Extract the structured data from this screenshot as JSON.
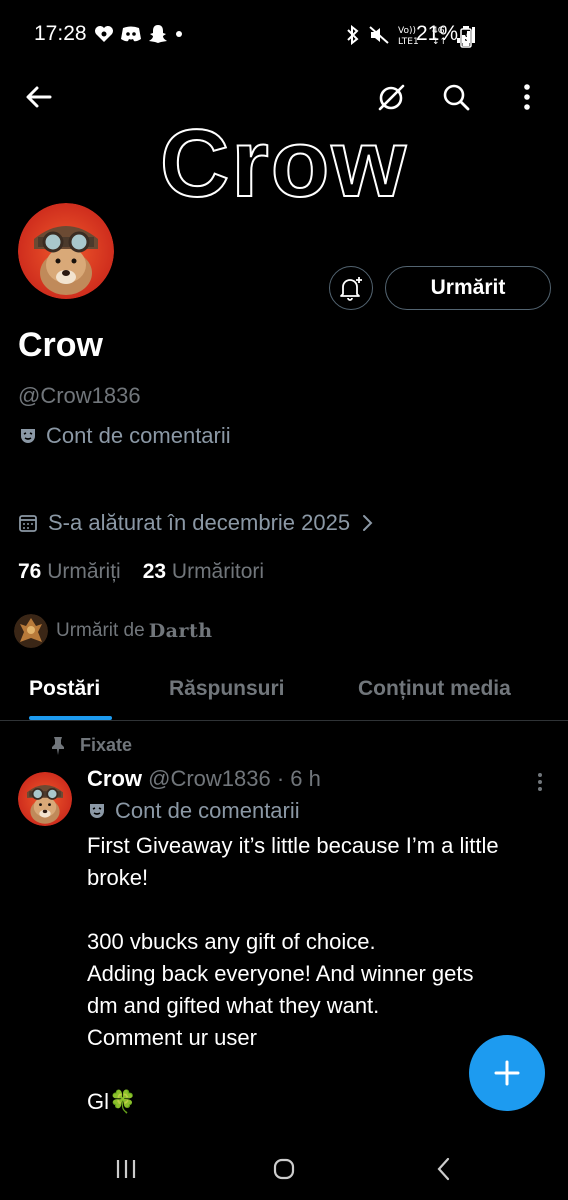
{
  "status_bar": {
    "time": "17:28",
    "battery": "21%",
    "network": "4G",
    "volte": "Vo)) LTE1"
  },
  "header": {
    "back_icon": "arrow-left-icon",
    "banner_title": "Crow"
  },
  "profile": {
    "display_name": "Crow",
    "handle": "@Crow1836",
    "account_label": "Cont de comentarii",
    "follow_button": "Urmărit",
    "joined": "S-a alăturat în decembrie 2025",
    "following_count": "76",
    "following_label": "Urmăriți",
    "followers_count": "23",
    "followers_label": "Urmăritori",
    "followed_by_prefix": "Urmărit de",
    "followed_by_name": "Darth"
  },
  "tabs": [
    {
      "label": "Postări",
      "active": true
    },
    {
      "label": "Răspunsuri",
      "active": false
    },
    {
      "label": "Conținut media",
      "active": false
    }
  ],
  "post": {
    "pinned_label": "Fixate",
    "name": "Crow",
    "handle_time": "@Crow1836 · 6 h",
    "account_label": "Cont de comentarii",
    "paragraphs": [
      "First Giveaway it’s little because I’m a little broke!",
      "300 vbucks any gift of choice.\nAdding back everyone! And winner gets dm and gifted what they want.\nComment ur user",
      "Gl🍀"
    ]
  },
  "colors": {
    "accent": "#1d9bf0",
    "background": "#000000",
    "muted_text": "#71767b",
    "border": "#2f3336"
  }
}
